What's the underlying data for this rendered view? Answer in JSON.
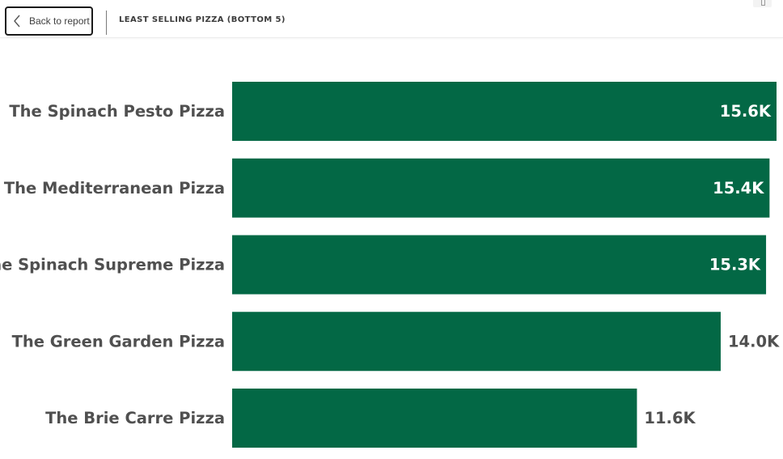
{
  "header": {
    "back_label": "Back to report",
    "title": "LEAST SELLING PIZZA (BOTTOM 5)"
  },
  "colors": {
    "bar": "#036845",
    "label_inside": "#ffffff",
    "label_outside": "#505050",
    "category_text": "#505050"
  },
  "chart_data": {
    "type": "bar",
    "orientation": "horizontal",
    "title": "LEAST SELLING PIZZA (BOTTOM 5)",
    "xlabel": "",
    "ylabel": "",
    "xlim": [
      0,
      15600
    ],
    "grid": false,
    "categories": [
      "The Spinach Pesto Pizza",
      "The Mediterranean Pizza",
      "The Spinach Supreme Pizza",
      "The Green Garden Pizza",
      "The Brie Carre Pizza"
    ],
    "values": [
      15600,
      15400,
      15300,
      14000,
      11600
    ],
    "data_labels": [
      "15.6K",
      "15.4K",
      "15.3K",
      "14.0K",
      "11.6K"
    ]
  }
}
